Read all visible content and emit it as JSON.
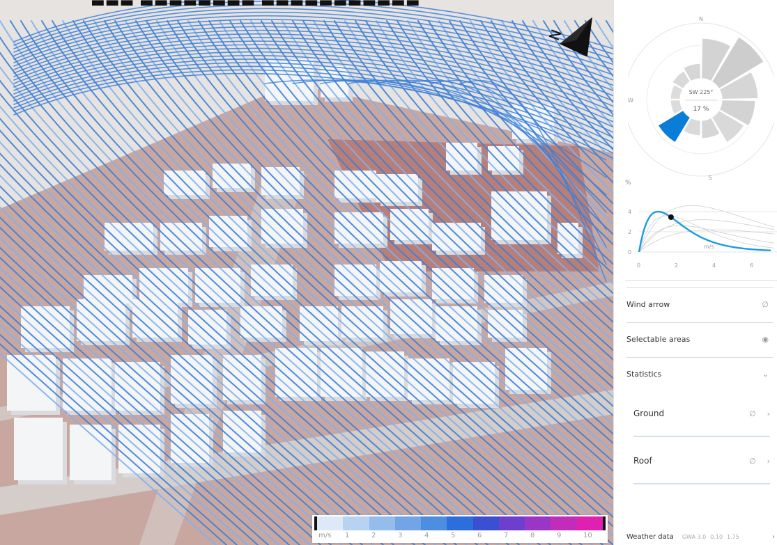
{
  "viewport": {
    "colors": {
      "sky": "#e6e3e0",
      "ground": "#c9a7a1",
      "plaza": "#b87e78",
      "road": "#d6d3d0",
      "building": "#f4f5f7",
      "building_shadow": "#d9dbdf",
      "streamline": "#3b7fd9",
      "streamline_light": "#7fb0ee"
    }
  },
  "legend": {
    "unit": "m/s",
    "ticks": [
      "1",
      "2",
      "3",
      "4",
      "5",
      "6",
      "7",
      "8",
      "9",
      "10"
    ],
    "colors": [
      "#dde9f6",
      "#b8d3f2",
      "#95bdec",
      "#72a5e6",
      "#4d8ee0",
      "#2c6fdc",
      "#3a4fd2",
      "#6d3fcc",
      "#9b35c5",
      "#c12cba",
      "#e020b0"
    ]
  },
  "wind_rose": {
    "north": "N",
    "west": "W",
    "south": "S",
    "direction": "SW 225°",
    "percentage": "17 %",
    "highlight_color": "#0a7dd6"
  },
  "distribution": {
    "y_label": "%",
    "x_label": "m/s",
    "x_ticks": [
      "0",
      "2",
      "4",
      "6"
    ],
    "y_ticks": [
      "0",
      "2",
      "4"
    ],
    "curve_color": "#1a9be0"
  },
  "panel": {
    "wind_arrow": {
      "label": "Wind arrow",
      "icon": "eye-slash-icon"
    },
    "selectable_areas": {
      "label": "Selectable areas",
      "icon": "eye-icon"
    },
    "statistics": {
      "label": "Statistics",
      "icon": "chevron-down-icon"
    },
    "ground": {
      "label": "Ground"
    },
    "roof": {
      "label": "Roof"
    },
    "weather": {
      "label": "Weather data",
      "values": [
        "GWA 3.0",
        "0.10",
        "1.75"
      ]
    }
  }
}
